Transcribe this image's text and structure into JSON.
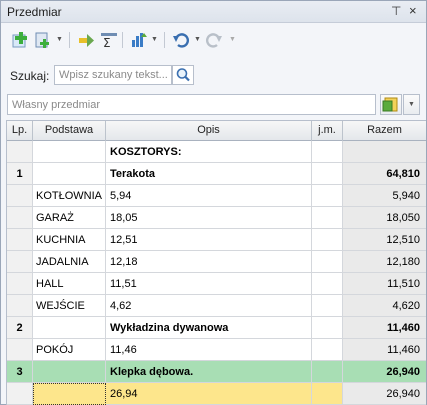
{
  "panel": {
    "title": "Przedmiar"
  },
  "toolbar": {
    "buttons": [
      {
        "icon": "add-green-plus-icon"
      },
      {
        "icon": "add-document-icon"
      },
      {
        "icon": "insert-arrow-icon"
      },
      {
        "icon": "sum-sigma-icon"
      },
      {
        "icon": "chart-sort-icon"
      },
      {
        "icon": "undo-icon"
      },
      {
        "icon": "redo-icon"
      }
    ]
  },
  "search": {
    "label": "Szukaj:",
    "placeholder": "Wpisz szukany tekst...",
    "value": ""
  },
  "own_measure": {
    "placeholder": "Własny przedmiar",
    "value": ""
  },
  "table": {
    "columns": [
      "Lp.",
      "Podstawa",
      "Opis",
      "j.m.",
      "Razem"
    ],
    "rows": [
      {
        "lp": "",
        "podstawa": "",
        "opis": "KOSZTORYS:",
        "jm": "",
        "razem": "",
        "bold": true
      },
      {
        "lp": "1",
        "podstawa": "",
        "opis": "Terakota",
        "jm": "",
        "razem": "64,810",
        "bold": true
      },
      {
        "lp": "",
        "podstawa": "KOTŁOWNIA",
        "opis": "5,94",
        "jm": "",
        "razem": "5,940"
      },
      {
        "lp": "",
        "podstawa": "GARAŻ",
        "opis": "18,05",
        "jm": "",
        "razem": "18,050"
      },
      {
        "lp": "",
        "podstawa": "KUCHNIA",
        "opis": "12,51",
        "jm": "",
        "razem": "12,510"
      },
      {
        "lp": "",
        "podstawa": "JADALNIA",
        "opis": "12,18",
        "jm": "",
        "razem": "12,180"
      },
      {
        "lp": "",
        "podstawa": "HALL",
        "opis": "11,51",
        "jm": "",
        "razem": "11,510"
      },
      {
        "lp": "",
        "podstawa": "WEJŚCIE",
        "opis": "4,62",
        "jm": "",
        "razem": "4,620"
      },
      {
        "lp": "2",
        "podstawa": "",
        "opis": "Wykładzina dywanowa",
        "jm": "",
        "razem": "11,460",
        "bold": true
      },
      {
        "lp": "",
        "podstawa": "POKÓJ",
        "opis": "11,46",
        "jm": "",
        "razem": "11,460"
      },
      {
        "lp": "3",
        "podstawa": "",
        "opis": "Klepka dębowa.",
        "jm": "",
        "razem": "26,940",
        "bold": true,
        "selected": true
      },
      {
        "lp": "",
        "podstawa": "",
        "opis": "26,94",
        "jm": "",
        "razem": "26,940",
        "current": true
      }
    ]
  },
  "colors": {
    "selected_row": "#a8deb4",
    "current_row": "#fde68c",
    "header": "#e4e7eb"
  }
}
